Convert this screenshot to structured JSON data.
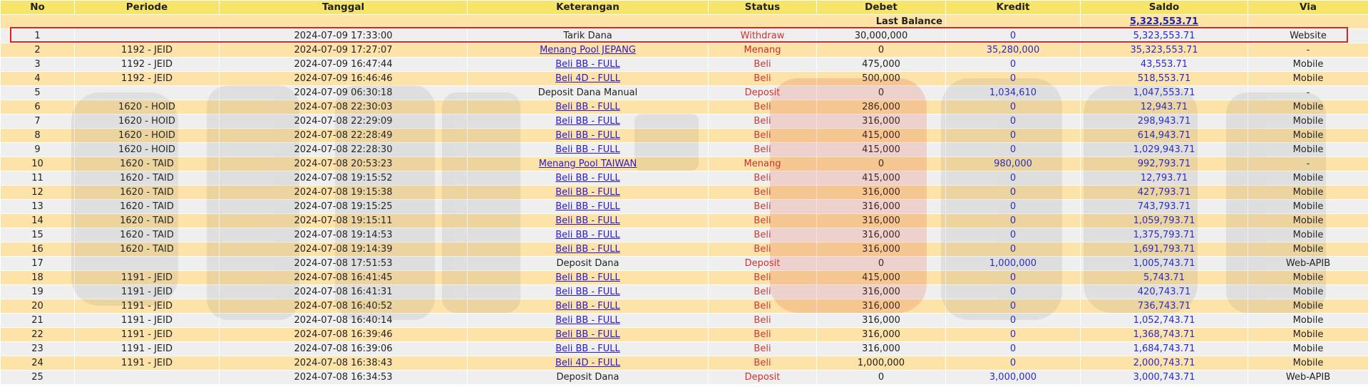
{
  "headers": [
    "No",
    "Periode",
    "Tanggal",
    "Keterangan",
    "Status",
    "Debet",
    "Kredit",
    "Saldo",
    "Via"
  ],
  "last_balance": {
    "label": "Last Balance",
    "value": "5,323,553.71"
  },
  "rows": [
    {
      "no": "1",
      "periode": "",
      "tanggal": "2024-07-09 17:33:00",
      "keterangan": "Tarik Dana",
      "link": false,
      "status": "Withdraw",
      "debet": "30,000,000",
      "kredit": "0",
      "saldo": "5,323,553.71",
      "via": "Website"
    },
    {
      "no": "2",
      "periode": "1192 - JEID",
      "tanggal": "2024-07-09 17:27:07",
      "keterangan": "Menang Pool JEPANG",
      "link": true,
      "status": "Menang",
      "debet": "0",
      "kredit": "35,280,000",
      "saldo": "35,323,553.71",
      "via": "-"
    },
    {
      "no": "3",
      "periode": "1192 - JEID",
      "tanggal": "2024-07-09 16:47:44",
      "keterangan": "Beli BB - FULL",
      "link": true,
      "status": "Beli",
      "debet": "475,000",
      "kredit": "0",
      "saldo": "43,553.71",
      "via": "Mobile"
    },
    {
      "no": "4",
      "periode": "1192 - JEID",
      "tanggal": "2024-07-09 16:46:46",
      "keterangan": "Beli 4D - FULL",
      "link": true,
      "status": "Beli",
      "debet": "500,000",
      "kredit": "0",
      "saldo": "518,553.71",
      "via": "Mobile"
    },
    {
      "no": "5",
      "periode": "",
      "tanggal": "2024-07-09 06:30:18",
      "keterangan": "Deposit Dana Manual",
      "link": false,
      "status": "Deposit",
      "debet": "0",
      "kredit": "1,034,610",
      "saldo": "1,047,553.71",
      "via": "-"
    },
    {
      "no": "6",
      "periode": "1620 - HOID",
      "tanggal": "2024-07-08 22:30:03",
      "keterangan": "Beli BB - FULL",
      "link": true,
      "status": "Beli",
      "debet": "286,000",
      "kredit": "0",
      "saldo": "12,943.71",
      "via": "Mobile"
    },
    {
      "no": "7",
      "periode": "1620 - HOID",
      "tanggal": "2024-07-08 22:29:09",
      "keterangan": "Beli BB - FULL",
      "link": true,
      "status": "Beli",
      "debet": "316,000",
      "kredit": "0",
      "saldo": "298,943.71",
      "via": "Mobile"
    },
    {
      "no": "8",
      "periode": "1620 - HOID",
      "tanggal": "2024-07-08 22:28:49",
      "keterangan": "Beli BB - FULL",
      "link": true,
      "status": "Beli",
      "debet": "415,000",
      "kredit": "0",
      "saldo": "614,943.71",
      "via": "Mobile"
    },
    {
      "no": "9",
      "periode": "1620 - HOID",
      "tanggal": "2024-07-08 22:28:30",
      "keterangan": "Beli BB - FULL",
      "link": true,
      "status": "Beli",
      "debet": "415,000",
      "kredit": "0",
      "saldo": "1,029,943.71",
      "via": "Mobile"
    },
    {
      "no": "10",
      "periode": "1620 - TAID",
      "tanggal": "2024-07-08 20:53:23",
      "keterangan": "Menang Pool TAIWAN",
      "link": true,
      "status": "Menang",
      "debet": "0",
      "kredit": "980,000",
      "saldo": "992,793.71",
      "via": "-"
    },
    {
      "no": "11",
      "periode": "1620 - TAID",
      "tanggal": "2024-07-08 19:15:52",
      "keterangan": "Beli BB - FULL",
      "link": true,
      "status": "Beli",
      "debet": "415,000",
      "kredit": "0",
      "saldo": "12,793.71",
      "via": "Mobile"
    },
    {
      "no": "12",
      "periode": "1620 - TAID",
      "tanggal": "2024-07-08 19:15:38",
      "keterangan": "Beli BB - FULL",
      "link": true,
      "status": "Beli",
      "debet": "316,000",
      "kredit": "0",
      "saldo": "427,793.71",
      "via": "Mobile"
    },
    {
      "no": "13",
      "periode": "1620 - TAID",
      "tanggal": "2024-07-08 19:15:25",
      "keterangan": "Beli BB - FULL",
      "link": true,
      "status": "Beli",
      "debet": "316,000",
      "kredit": "0",
      "saldo": "743,793.71",
      "via": "Mobile"
    },
    {
      "no": "14",
      "periode": "1620 - TAID",
      "tanggal": "2024-07-08 19:15:11",
      "keterangan": "Beli BB - FULL",
      "link": true,
      "status": "Beli",
      "debet": "316,000",
      "kredit": "0",
      "saldo": "1,059,793.71",
      "via": "Mobile"
    },
    {
      "no": "15",
      "periode": "1620 - TAID",
      "tanggal": "2024-07-08 19:14:53",
      "keterangan": "Beli BB - FULL",
      "link": true,
      "status": "Beli",
      "debet": "316,000",
      "kredit": "0",
      "saldo": "1,375,793.71",
      "via": "Mobile"
    },
    {
      "no": "16",
      "periode": "1620 - TAID",
      "tanggal": "2024-07-08 19:14:39",
      "keterangan": "Beli BB - FULL",
      "link": true,
      "status": "Beli",
      "debet": "316,000",
      "kredit": "0",
      "saldo": "1,691,793.71",
      "via": "Mobile"
    },
    {
      "no": "17",
      "periode": "",
      "tanggal": "2024-07-08 17:51:53",
      "keterangan": "Deposit Dana",
      "link": false,
      "status": "Deposit",
      "debet": "0",
      "kredit": "1,000,000",
      "saldo": "1,005,743.71",
      "via": "Web-APIB"
    },
    {
      "no": "18",
      "periode": "1191 - JEID",
      "tanggal": "2024-07-08 16:41:45",
      "keterangan": "Beli BB - FULL",
      "link": true,
      "status": "Beli",
      "debet": "415,000",
      "kredit": "0",
      "saldo": "5,743.71",
      "via": "Mobile"
    },
    {
      "no": "19",
      "periode": "1191 - JEID",
      "tanggal": "2024-07-08 16:41:31",
      "keterangan": "Beli BB - FULL",
      "link": true,
      "status": "Beli",
      "debet": "316,000",
      "kredit": "0",
      "saldo": "420,743.71",
      "via": "Mobile"
    },
    {
      "no": "20",
      "periode": "1191 - JEID",
      "tanggal": "2024-07-08 16:40:52",
      "keterangan": "Beli BB - FULL",
      "link": true,
      "status": "Beli",
      "debet": "316,000",
      "kredit": "0",
      "saldo": "736,743.71",
      "via": "Mobile"
    },
    {
      "no": "21",
      "periode": "1191 - JEID",
      "tanggal": "2024-07-08 16:40:14",
      "keterangan": "Beli BB - FULL",
      "link": true,
      "status": "Beli",
      "debet": "316,000",
      "kredit": "0",
      "saldo": "1,052,743.71",
      "via": "Mobile"
    },
    {
      "no": "22",
      "periode": "1191 - JEID",
      "tanggal": "2024-07-08 16:39:46",
      "keterangan": "Beli BB - FULL",
      "link": true,
      "status": "Beli",
      "debet": "316,000",
      "kredit": "0",
      "saldo": "1,368,743.71",
      "via": "Mobile"
    },
    {
      "no": "23",
      "periode": "1191 - JEID",
      "tanggal": "2024-07-08 16:39:06",
      "keterangan": "Beli BB - FULL",
      "link": true,
      "status": "Beli",
      "debet": "316,000",
      "kredit": "0",
      "saldo": "1,684,743.71",
      "via": "Mobile"
    },
    {
      "no": "24",
      "periode": "1191 - JEID",
      "tanggal": "2024-07-08 16:38:43",
      "keterangan": "Beli 4D - FULL",
      "link": true,
      "status": "Beli",
      "debet": "1,000,000",
      "kredit": "0",
      "saldo": "2,000,743.71",
      "via": "Mobile"
    },
    {
      "no": "25",
      "periode": "",
      "tanggal": "2024-07-08 16:34:53",
      "keterangan": "Deposit Dana",
      "link": false,
      "status": "Deposit",
      "debet": "0",
      "kredit": "3,000,000",
      "saldo": "3,000,743.71",
      "via": "Web-APIB"
    }
  ],
  "colors": {
    "header": "#f7e46b",
    "row_odd": "#efefef",
    "row_even": "#fde3a8",
    "link": "#2a1bc4",
    "status_red": "#d03030",
    "amount_blue": "#2a2ac8",
    "highlight": "#d8231f"
  }
}
